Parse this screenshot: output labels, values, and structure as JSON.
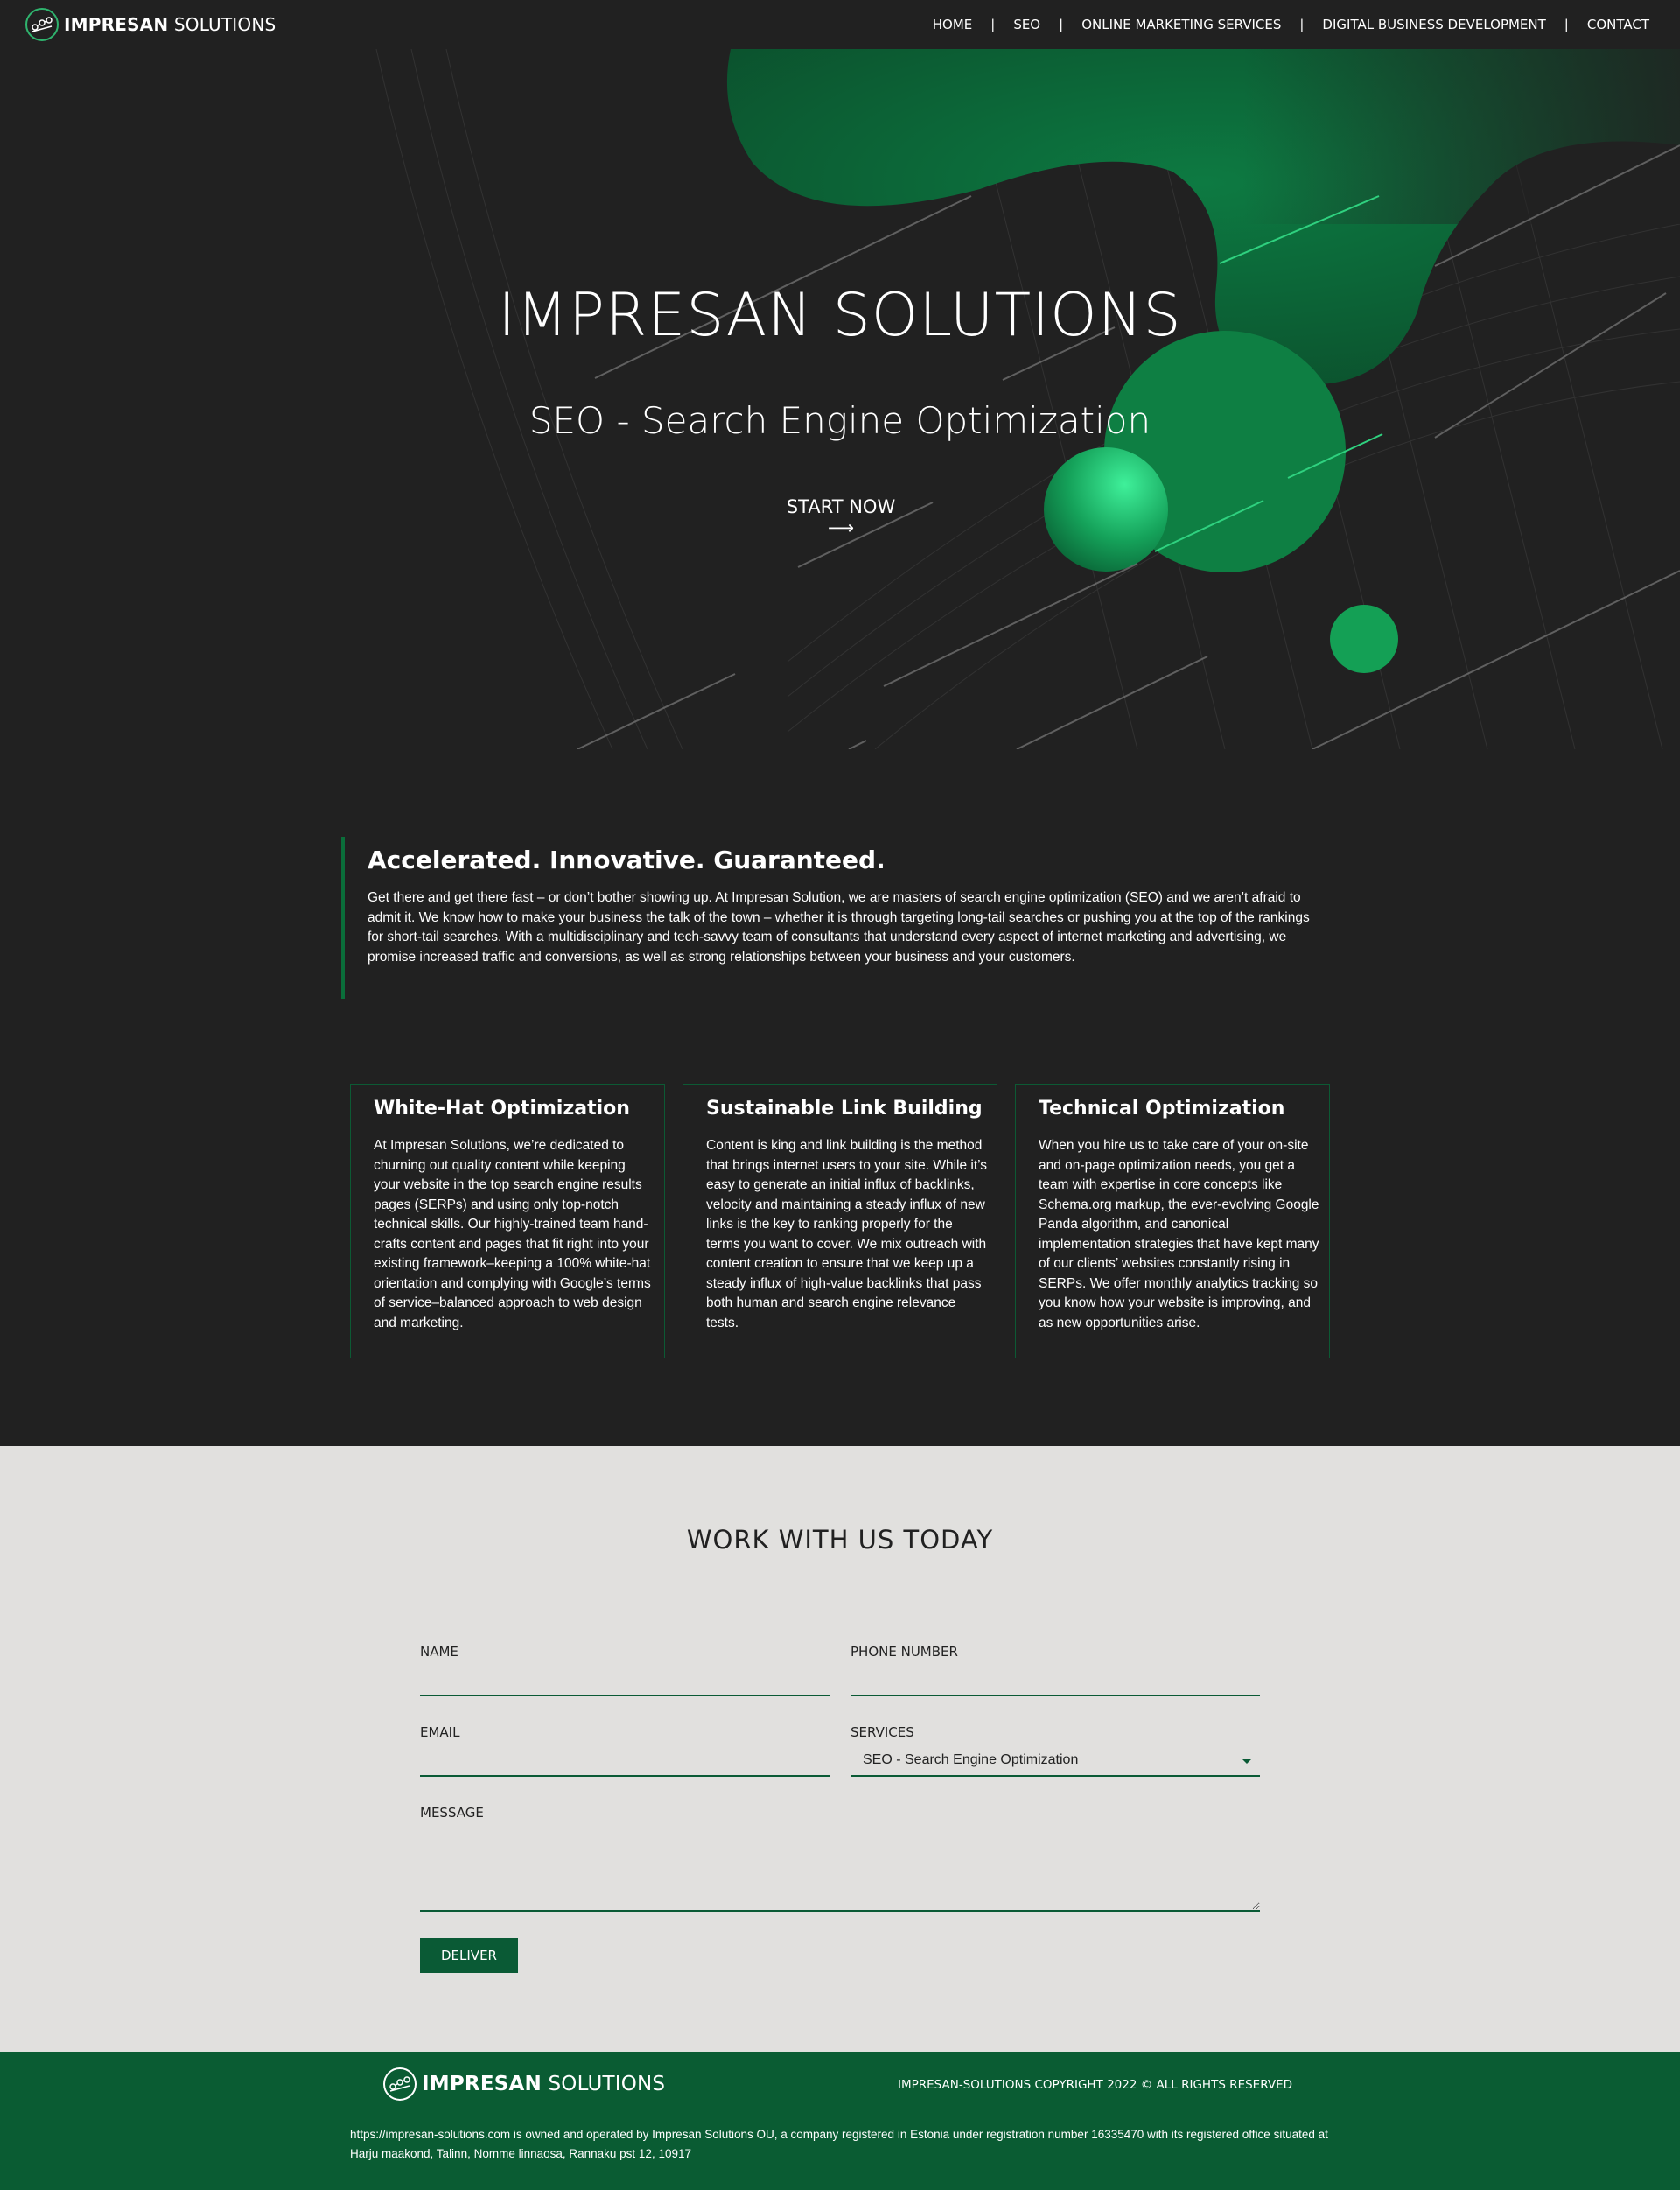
{
  "brand": {
    "name_bold": "IMPRESAN",
    "name_light": "SOLUTIONS"
  },
  "nav": {
    "items": [
      "HOME",
      "SEO",
      "ONLINE MARKETING SERVICES",
      "DIGITAL BUSINESS DEVELOPMENT",
      "CONTACT"
    ],
    "separator": "|"
  },
  "hero": {
    "title": "IMPRESAN SOLUTIONS",
    "subtitle": "SEO - Search Engine Optimization",
    "cta": "START NOW ⟶"
  },
  "intro": {
    "heading": "Accelerated. Innovative. Guaranteed.",
    "body": "Get there and get there fast – or don’t bother showing up. At Impresan Solution, we are masters of search engine optimization (SEO) and we aren’t afraid to admit it. We know how to make your business the talk of the town – whether it is through targeting long-tail searches or pushing you at the top of the rankings for short-tail searches. With a multidisciplinary and tech-savvy team of consultants that understand every aspect of internet marketing and advertising, we promise increased traffic and conversions, as well as strong relationships between your business and your customers."
  },
  "cards": [
    {
      "title": "White-Hat Optimization",
      "body": "At Impresan Solutions, we’re dedicated to churning out quality content while keeping your website in the top search engine results pages (SERPs) and using only top-notch technical skills. Our highly-trained team hand-crafts content and pages that fit right into your existing framework–keeping a 100% white-hat orientation and complying with Google’s terms of service–balanced approach to web design and marketing."
    },
    {
      "title": "Sustainable Link Building",
      "body": "Content is king and link building is the method that brings internet users to your site. While it’s easy to generate an initial influx of backlinks, velocity and maintaining a steady influx of new links is the key to ranking properly for the terms you want to cover. We mix outreach with content creation to ensure that we keep up a steady influx of high-value backlinks that pass both human and search engine relevance tests."
    },
    {
      "title": "Technical Optimization",
      "body": "When you hire us to take care of your on-site and on-page optimization needs, you get a team with expertise in core concepts like Schema.org markup, the ever-evolving Google Panda algorithm, and canonical implementation strategies that have kept many of our clients’ websites constantly rising in SERPs. We offer monthly analytics tracking so you know how your website is improving, and as new opportunities arise."
    }
  ],
  "contact": {
    "heading": "WORK WITH US TODAY",
    "name_label": "NAME",
    "phone_label": "PHONE NUMBER",
    "email_label": "EMAIL",
    "services_label": "SERVICES",
    "services_selected": "SEO - Search Engine Optimization",
    "message_label": "MESSAGE",
    "submit": "DELIVER"
  },
  "footer": {
    "copyright": "IMPRESAN-SOLUTIONS COPYRIGHT 2022 © ALL RIGHTS RESERVED",
    "legal": "https://impresan-solutions.com is owned and operated by Impresan Solutions OU, a company registered in Estonia under registration number 16335470 with its registered office situated at Harju maakond, Talinn, Nomme linnaosa, Rannaku pst 12, 10917"
  },
  "colors": {
    "background": "#212121",
    "accent": "#0a5c33",
    "bright_green": "#2fd17f",
    "form_bg": "#e1e0de"
  }
}
